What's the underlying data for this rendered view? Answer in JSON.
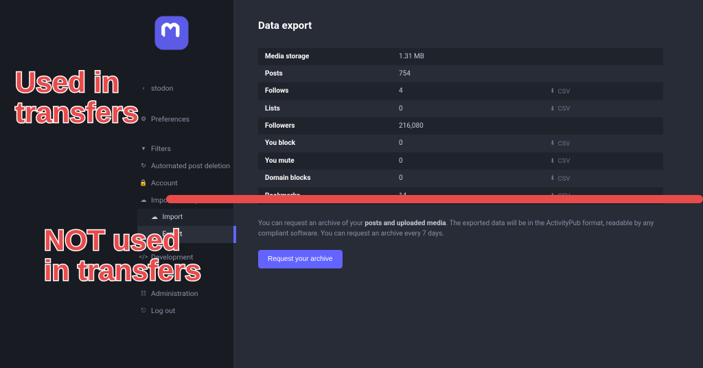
{
  "sidebar": {
    "home_label": "stodon",
    "items": [
      {
        "icon": "gear",
        "label": "Preferences"
      },
      {
        "icon": "filter",
        "label": "Filters"
      },
      {
        "icon": "clock",
        "label": "Automated post deletion"
      },
      {
        "icon": "lock",
        "label": "Account"
      },
      {
        "icon": "cloud",
        "label": "Import and export"
      }
    ],
    "sub_items": [
      {
        "label": "Import",
        "active": false
      },
      {
        "label": "Export",
        "active": true
      }
    ],
    "items2": [
      {
        "icon": "code",
        "label": "Development"
      },
      {
        "icon": "blank",
        "label": ""
      },
      {
        "icon": "sliders",
        "label": "Administration"
      },
      {
        "icon": "logout",
        "label": "Log out"
      }
    ]
  },
  "main": {
    "title": "Data export",
    "rows": [
      {
        "label": "Media storage",
        "value": "1.31 MB",
        "csv": false
      },
      {
        "label": "Posts",
        "value": "754",
        "csv": false
      },
      {
        "label": "Follows",
        "value": "4",
        "csv": true
      },
      {
        "label": "Lists",
        "value": "0",
        "csv": true
      },
      {
        "label": "Followers",
        "value": "216,080",
        "csv": false
      },
      {
        "label": "You block",
        "value": "0",
        "csv": true
      },
      {
        "label": "You mute",
        "value": "0",
        "csv": true
      },
      {
        "label": "Domain blocks",
        "value": "0",
        "csv": true
      },
      {
        "label": "Bookmarks",
        "value": "14",
        "csv": true
      }
    ],
    "csv_label": "CSV",
    "info_pre": "You can request an archive of your ",
    "info_strong": "posts and uploaded media",
    "info_post": ". The exported data will be in the ActivityPub format, readable by any compliant software. You can request an archive every 7 days.",
    "button": "Request your archive"
  },
  "annotations": {
    "top": "Used in\ntransfers",
    "bottom": "NOT used\nin transfers"
  }
}
